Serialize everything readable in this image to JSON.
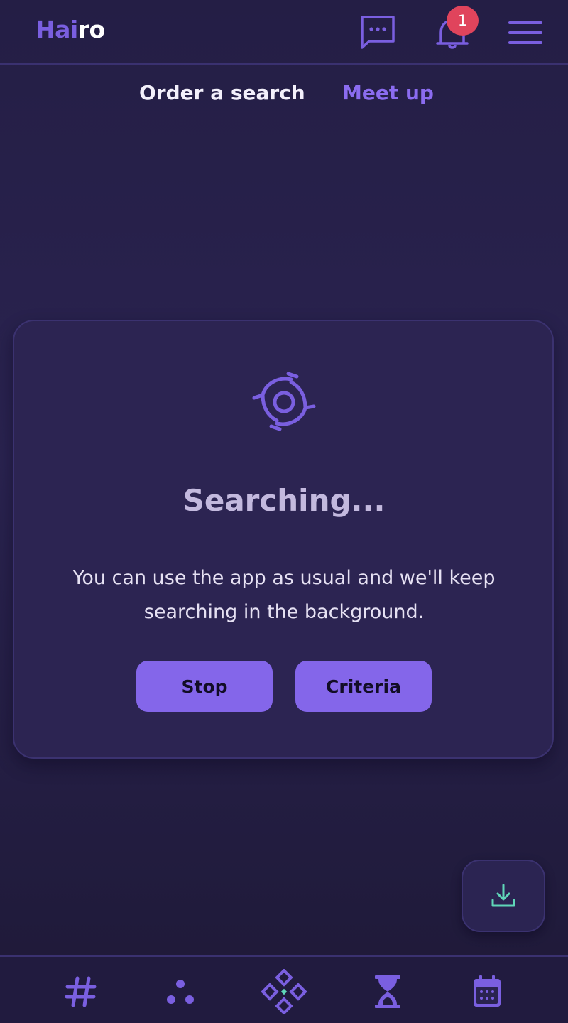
{
  "app": {
    "logo_part1": "Hai",
    "logo_part2": "ro"
  },
  "header": {
    "icons": [
      "chat-icon",
      "bell-icon",
      "hamburger-menu-icon"
    ],
    "notification_count": "1"
  },
  "tabs": [
    {
      "label": "Order a search"
    },
    {
      "label": "Meet up"
    }
  ],
  "search_card": {
    "icon": "radar-search-icon",
    "title": "Searching...",
    "description": "You can use the app as usual and we'll keep searching in the background.",
    "stop_label": "Stop",
    "criteria_label": "Criteria"
  },
  "fab": {
    "icon": "download-icon"
  },
  "bottom_nav": {
    "items": [
      "hashtag-icon",
      "dots-icon",
      "diamond-grid-icon",
      "hourglass-icon",
      "calendar-icon"
    ]
  },
  "colors": {
    "background": "#241e45",
    "accent": "#8466ea",
    "badge": "#e0445c",
    "download_icon": "#5fd6b8"
  }
}
